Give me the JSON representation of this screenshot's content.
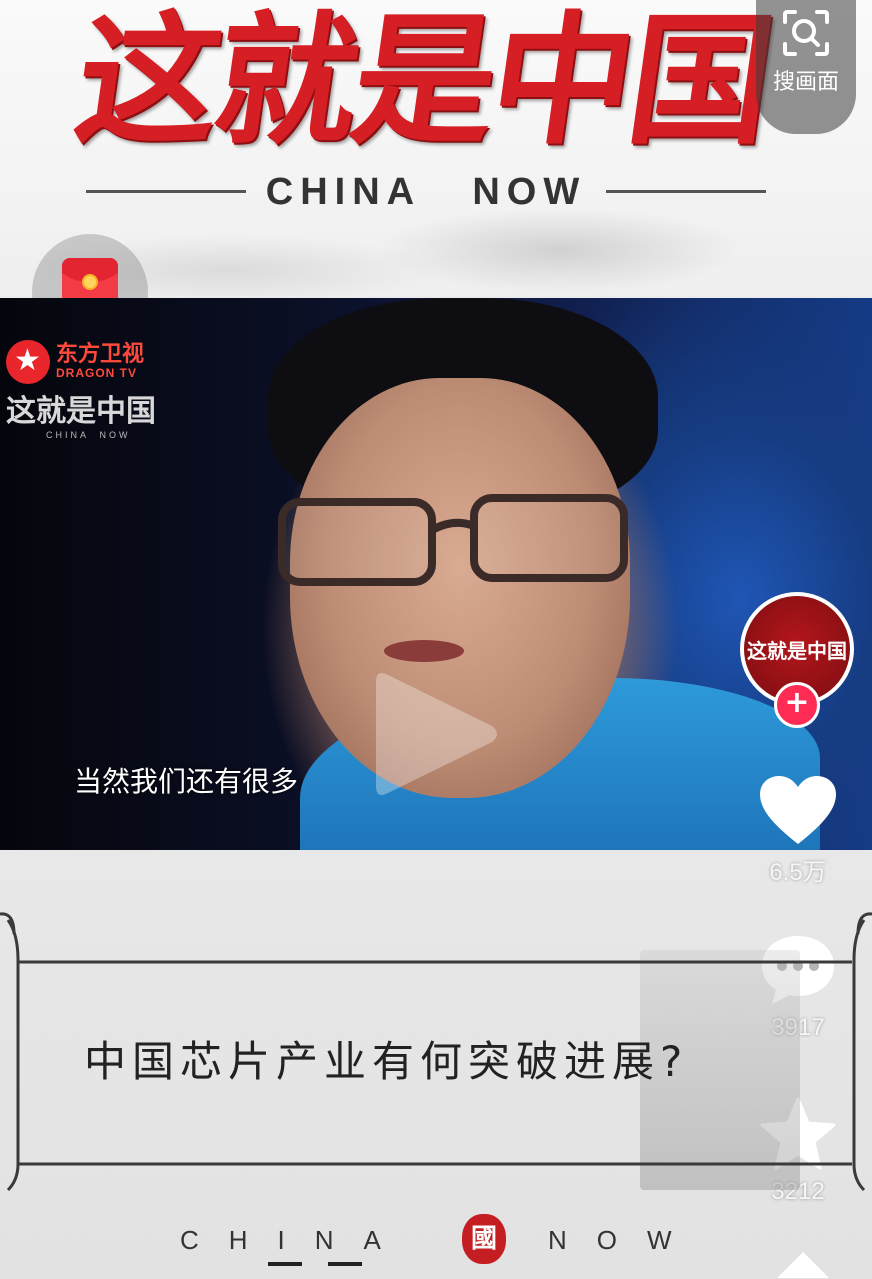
{
  "header": {
    "title": "这就是中国",
    "subtitle": "CHINA   NOW"
  },
  "search_screen": {
    "label": "搜画面",
    "icon": "scan-search-icon"
  },
  "red_packet": {
    "icon": "red-envelope-icon"
  },
  "video": {
    "channel_logo_cn": "东方卫视",
    "channel_logo_en": "DRAGON TV",
    "show_logo_cn": "这就是中国",
    "show_logo_en": "CHINA  NOW",
    "subtitle": "当然我们还有很多",
    "play_icon": "play-icon"
  },
  "creator": {
    "avatar_text": "这就是中国",
    "follow_label": "+"
  },
  "actions": {
    "like_count": "6.5万",
    "comment_count": "3917",
    "favorite_count": "3212"
  },
  "card": {
    "question": "中国芯片产业有何突破进展?"
  },
  "footer": {
    "left_text": "CHINA",
    "seal_char": "國",
    "right_text": "NOW"
  },
  "colors": {
    "brand_red": "#d61f24",
    "follow_pink": "#fe2c55"
  }
}
